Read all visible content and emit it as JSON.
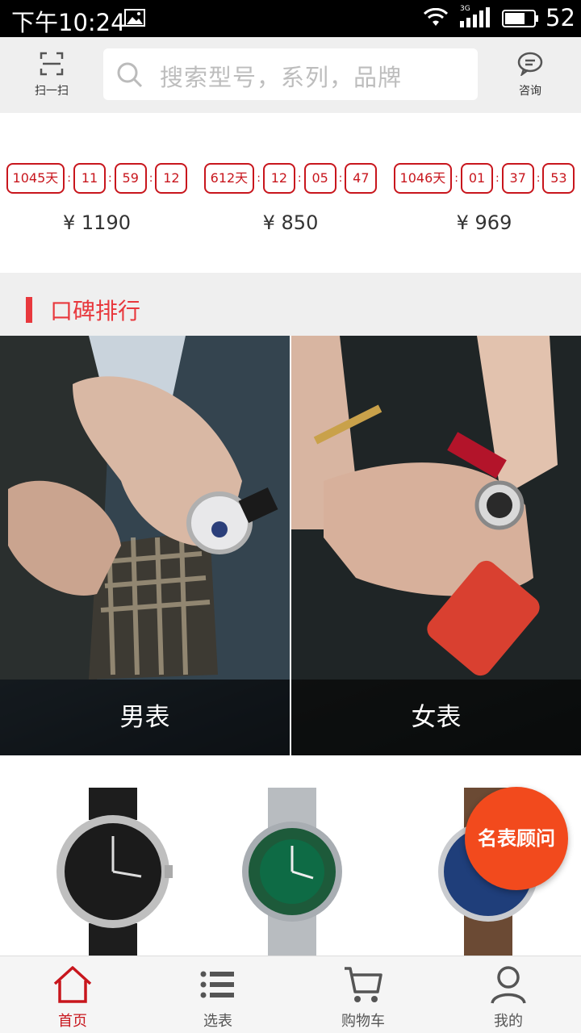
{
  "status_bar": {
    "time": "下午10:24",
    "network_label": "3G",
    "battery": "52"
  },
  "header": {
    "scan_label": "扫一扫",
    "search_placeholder": "搜索型号，系列，品牌",
    "consult_label": "咨询"
  },
  "flash_sale": [
    {
      "days": "1045天",
      "hours": "11",
      "minutes": "59",
      "seconds": "12",
      "price": "¥ 1190"
    },
    {
      "days": "612天",
      "hours": "12",
      "minutes": "05",
      "seconds": "47",
      "price": "¥ 850"
    },
    {
      "days": "1046天",
      "hours": "01",
      "minutes": "37",
      "seconds": "53",
      "price": "¥ 969"
    }
  ],
  "section": {
    "title": "口碑排行"
  },
  "categories": {
    "men": "男表",
    "women": "女表"
  },
  "floating_button": "名表顾问",
  "tabs": [
    {
      "label": "首页",
      "icon": "home-icon"
    },
    {
      "label": "选表",
      "icon": "list-icon"
    },
    {
      "label": "购物车",
      "icon": "cart-icon"
    },
    {
      "label": "我的",
      "icon": "user-icon"
    }
  ],
  "colors": {
    "accent": "#c8161d",
    "section_accent": "#e8383d",
    "float_button": "#f24a1d"
  }
}
